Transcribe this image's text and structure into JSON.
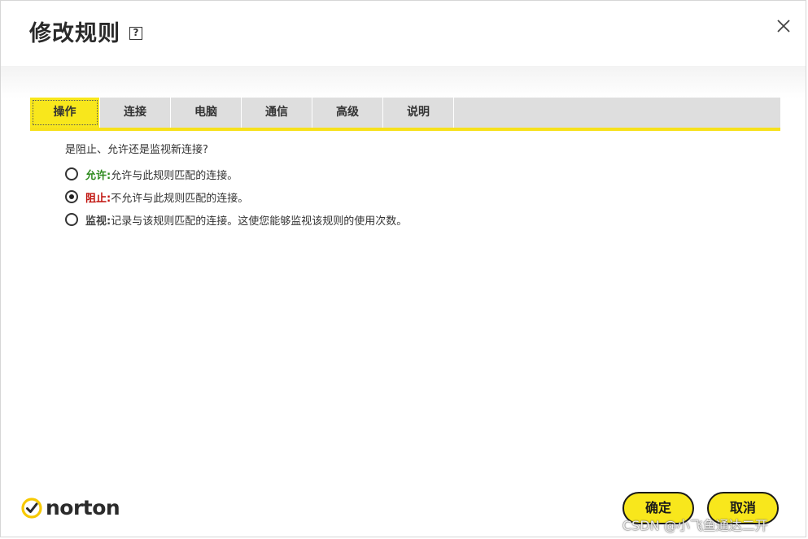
{
  "dialog": {
    "title": "修改规则",
    "help_icon": "?"
  },
  "tabs": [
    {
      "label": "操作",
      "active": true
    },
    {
      "label": "连接",
      "active": false
    },
    {
      "label": "电脑",
      "active": false
    },
    {
      "label": "通信",
      "active": false
    },
    {
      "label": "高级",
      "active": false
    },
    {
      "label": "说明",
      "active": false
    }
  ],
  "content": {
    "question": "是阻止、允许还是监视新连接?",
    "options": [
      {
        "label": "允许:",
        "description": "允许与此规则匹配的连接。",
        "checked": false,
        "color": "#2e8b1e"
      },
      {
        "label": "阻止:",
        "description": "不允许与此规则匹配的连接。",
        "checked": true,
        "color": "#c0120c"
      },
      {
        "label": "监视:",
        "description": "记录与该规则匹配的连接。这使您能够监视该规则的使用次数。",
        "checked": false,
        "color": "#444444"
      }
    ]
  },
  "footer": {
    "logo_text": "norton",
    "ok_label": "确定",
    "cancel_label": "取消"
  },
  "watermark": "CSDN @小飞鱼通达二开",
  "colors": {
    "accent": "#f8e71c",
    "tab_bar": "#dedede",
    "logo_check": "#f7c900"
  },
  "icons": {
    "close": "close-icon",
    "help": "help-icon",
    "logo": "norton-check-icon"
  }
}
